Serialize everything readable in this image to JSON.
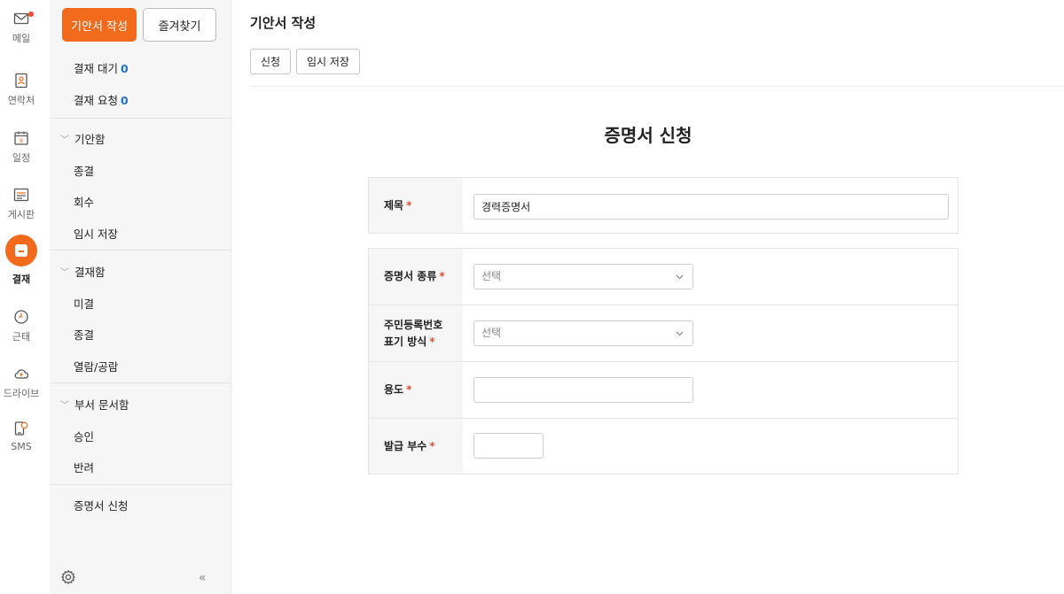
{
  "rail": {
    "items": [
      {
        "label": "메일",
        "icon": "mail-icon"
      },
      {
        "label": "연락처",
        "icon": "contacts-icon"
      },
      {
        "label": "일정",
        "icon": "calendar-icon"
      },
      {
        "label": "게시판",
        "icon": "board-icon"
      },
      {
        "label": "결재",
        "icon": "approval-icon",
        "active": true
      },
      {
        "label": "근태",
        "icon": "clock-icon"
      },
      {
        "label": "드라이브",
        "icon": "cloud-icon"
      },
      {
        "label": "SMS",
        "icon": "sms-icon"
      }
    ],
    "accent": "#f26b1d"
  },
  "sidebar": {
    "draft_button": "기안서 작성",
    "favorites_button": "즐겨찾기",
    "pending_label": "결재 대기",
    "pending_count": "0",
    "request_label": "결재 요청",
    "request_count": "0",
    "groups": [
      {
        "title": "기안함",
        "items": [
          "종결",
          "회수",
          "임시 저장"
        ]
      },
      {
        "title": "결재함",
        "items": [
          "미결",
          "종결",
          "열람/공람"
        ]
      },
      {
        "title": "부서 문서함",
        "items": [
          "승인",
          "반려"
        ]
      }
    ],
    "certificate_item": "증명서 신청"
  },
  "main": {
    "page_title": "기안서 작성",
    "toolbar": {
      "submit": "신청",
      "save_draft": "임시 저장"
    },
    "doc_title": "증명서 신청",
    "form": {
      "subject_label": "제목",
      "subject_value": "경력증명서",
      "cert_type_label": "증명서 종류",
      "cert_type_placeholder": "선택",
      "rrn_label_line1": "주민등록번호",
      "rrn_label_line2": "표기 방식",
      "rrn_placeholder": "선택",
      "purpose_label": "용도",
      "purpose_value": "",
      "copies_label": "발급 부수",
      "copies_value": "",
      "required_mark": "*"
    }
  }
}
